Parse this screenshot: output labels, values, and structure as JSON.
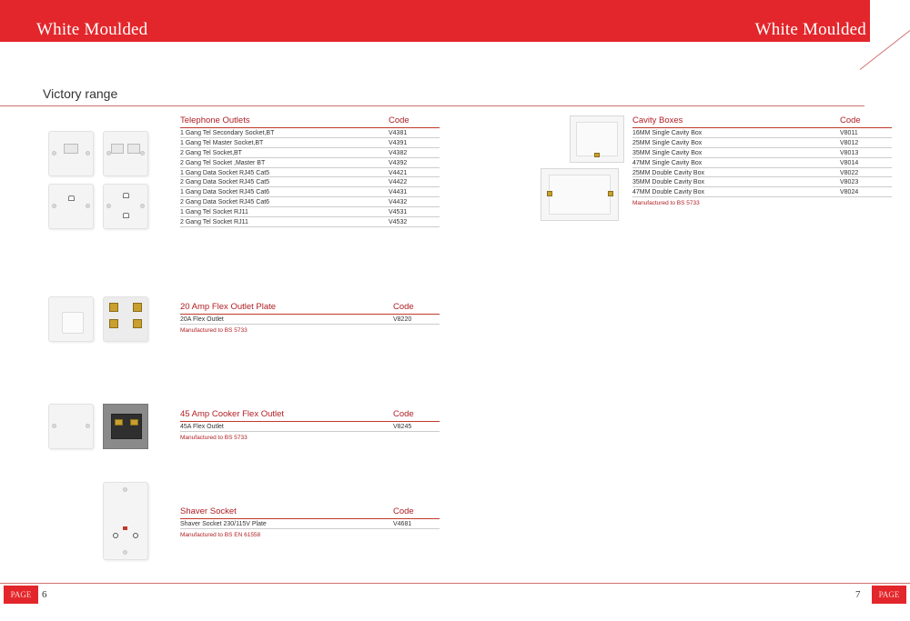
{
  "header": {
    "left_title": "White Moulded",
    "right_title": "White Moulded"
  },
  "range_title": "Victory range",
  "footer": {
    "left_tab": "PAGE",
    "left_page": "6",
    "right_tab": "PAGE",
    "right_page": "7"
  },
  "telephone": {
    "title": "Telephone Outlets",
    "code_label": "Code",
    "rows": [
      {
        "desc": "1 Gang Tel Secondary Socket,BT",
        "code": "V4381"
      },
      {
        "desc": "1 Gang Tel Master Socket,BT",
        "code": "V4391"
      },
      {
        "desc": "2 Gang Tel Socket,BT",
        "code": "V4382"
      },
      {
        "desc": "2 Gang Tel Socket ,Master BT",
        "code": "V4392"
      },
      {
        "desc": "1 Gang Data Socket RJ45 Cat5",
        "code": "V4421"
      },
      {
        "desc": "2 Gang Data Socket RJ45 Cat5",
        "code": "V4422"
      },
      {
        "desc": "1 Gang Data Socket RJ45 Cat6",
        "code": "V4431"
      },
      {
        "desc": "2 Gang Data Socket RJ45 Cat6",
        "code": "V4432"
      },
      {
        "desc": "1 Gang Tel Socket RJ11",
        "code": "V4531"
      },
      {
        "desc": "2 Gang Tel Socket RJ11",
        "code": "V4532"
      }
    ]
  },
  "flex20": {
    "title": "20 Amp Flex Outlet Plate",
    "code_label": "Code",
    "rows": [
      {
        "desc": "20A Flex Outlet",
        "code": "V8220"
      }
    ],
    "note": "Manufactured to BS 5733"
  },
  "cooker45": {
    "title": "45 Amp Cooker Flex Outlet",
    "code_label": "Code",
    "rows": [
      {
        "desc": "45A Flex Outlet",
        "code": "V8245"
      }
    ],
    "note": "Manufactured to BS 5733"
  },
  "shaver": {
    "title": "Shaver Socket",
    "code_label": "Code",
    "rows": [
      {
        "desc": "Shaver Socket 230/115V Plate",
        "code": "V4681"
      }
    ],
    "note": "Manufactured to BS EN 61558"
  },
  "cavity": {
    "title": "Cavity Boxes",
    "code_label": "Code",
    "rows": [
      {
        "desc": "16MM Single Cavity Box",
        "code": "V8011"
      },
      {
        "desc": "25MM Single Cavity Box",
        "code": "V8012"
      },
      {
        "desc": "35MM Single Cavity Box",
        "code": "V8013"
      },
      {
        "desc": "47MM Single Cavity Box",
        "code": "V8014"
      },
      {
        "desc": "25MM Double Cavity Box",
        "code": "V8022"
      },
      {
        "desc": "35MM Double Cavity Box",
        "code": "V8023"
      },
      {
        "desc": "47MM Double Cavity Box",
        "code": "V8024"
      }
    ],
    "note": "Manufactured to BS 5733"
  }
}
